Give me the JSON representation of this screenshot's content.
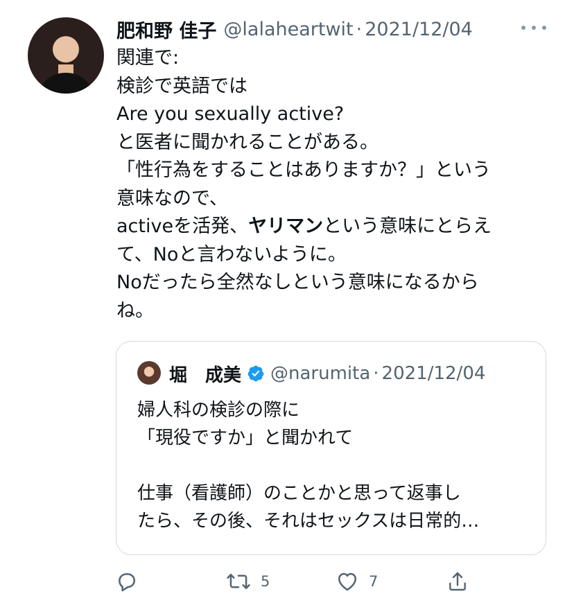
{
  "tweet": {
    "author_name": "肥和野 佳子",
    "author_handle": "@lalaheartwit",
    "separator": "·",
    "date": "2021/12/04",
    "body_lines": [
      "関連で:",
      "検診で英語では",
      "Are you sexually active?",
      "と医者に聞かれることがある。",
      "「性行為をすることはありますか？」という",
      "意味なので、"
    ],
    "line7_before": "activeを活発、",
    "line7_bold": "ヤリマン",
    "line7_after": "という意味にとらえ",
    "body_lines_tail": [
      "て、Noと言わないように。",
      "Noだったら全然なしという意味になるから",
      "ね。"
    ]
  },
  "quote": {
    "author_name": "堀　成美",
    "author_handle": "@narumita",
    "separator": "·",
    "date": "2021/12/04",
    "verified_icon": "verified-badge-icon",
    "body_lines": [
      "婦人科の検診の際に",
      "「現役ですか」と聞かれて",
      "",
      "仕事（看護師）のことかと思って返事し",
      "たら、その後、それはセックスは日常的…"
    ]
  },
  "actions": {
    "reply_icon": "reply-icon",
    "retweet_icon": "retweet-icon",
    "retweet_count": "5",
    "like_icon": "heart-icon",
    "like_count": "7",
    "share_icon": "share-icon"
  },
  "colors": {
    "text": "#0f1419",
    "secondary": "#536471",
    "border": "#cfd9de",
    "verified": "#1d9bf0"
  }
}
